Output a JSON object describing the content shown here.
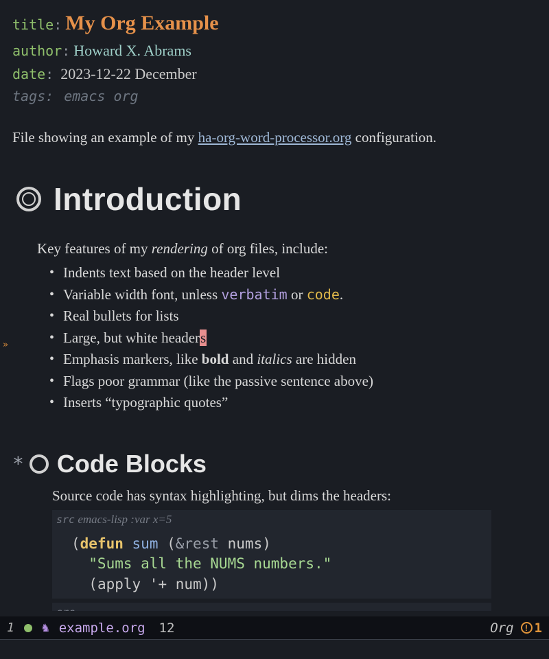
{
  "meta": {
    "title_key": "title",
    "title_val": "My Org Example",
    "author_key": "author",
    "author_val": "Howard X. Abrams",
    "date_key": "date",
    "date_val": "2023-12-22 December",
    "tags_key": "tags:",
    "tags_val": "emacs org"
  },
  "intro": {
    "pre": "File showing an example of my ",
    "link": "ha-org-word-processor.org",
    "post": " configuration."
  },
  "heading1": "Introduction",
  "section1": {
    "lead_pre": "Key features of my ",
    "lead_em": "rendering",
    "lead_post": " of org files, include:",
    "b1": "Indents text based on the header level",
    "b2_pre": "Variable width font, unless ",
    "b2_verb": "verbatim",
    "b2_mid": " or ",
    "b2_code": "code",
    "b2_post": ".",
    "b3": "Real bullets for lists",
    "b4_pre": "Large, but white header",
    "b4_cursor": "s",
    "b5_pre": "Emphasis markers, like ",
    "b5_bold": "bold",
    "b5_mid": " and ",
    "b5_italic": "italics",
    "b5_post": " are hidden",
    "b6": "Flags poor grammar (like the passive sentence above)",
    "b7": "Inserts “typographic quotes”"
  },
  "heading2_asterisk": "*",
  "heading2": "Code Blocks",
  "section2": {
    "lead": "Source code has syntax highlighting, but dims the headers:",
    "src_begin_kw": "src",
    "src_begin_rest": " emacs-lisp :var x=5",
    "code": {
      "l1a": "(",
      "l1b": "defun",
      "l1c": " ",
      "l1d": "sum",
      "l1e": " (",
      "l1f": "&rest",
      "l1g": " ",
      "l1h": "nums",
      "l1i": ")",
      "l2": "  \"Sums all the NUMS numbers.\"",
      "l3a": "  (",
      "l3b": "apply",
      "l3c": " '+ ",
      "l3d": "num",
      "l3e": "))"
    },
    "src_end": "src"
  },
  "modeline": {
    "window_num": "1",
    "horse": "♞",
    "file": "example.org",
    "line": "12",
    "mode": "Org",
    "warn_inner": "!",
    "warn_count": "1"
  },
  "fringe_arrow": "»"
}
